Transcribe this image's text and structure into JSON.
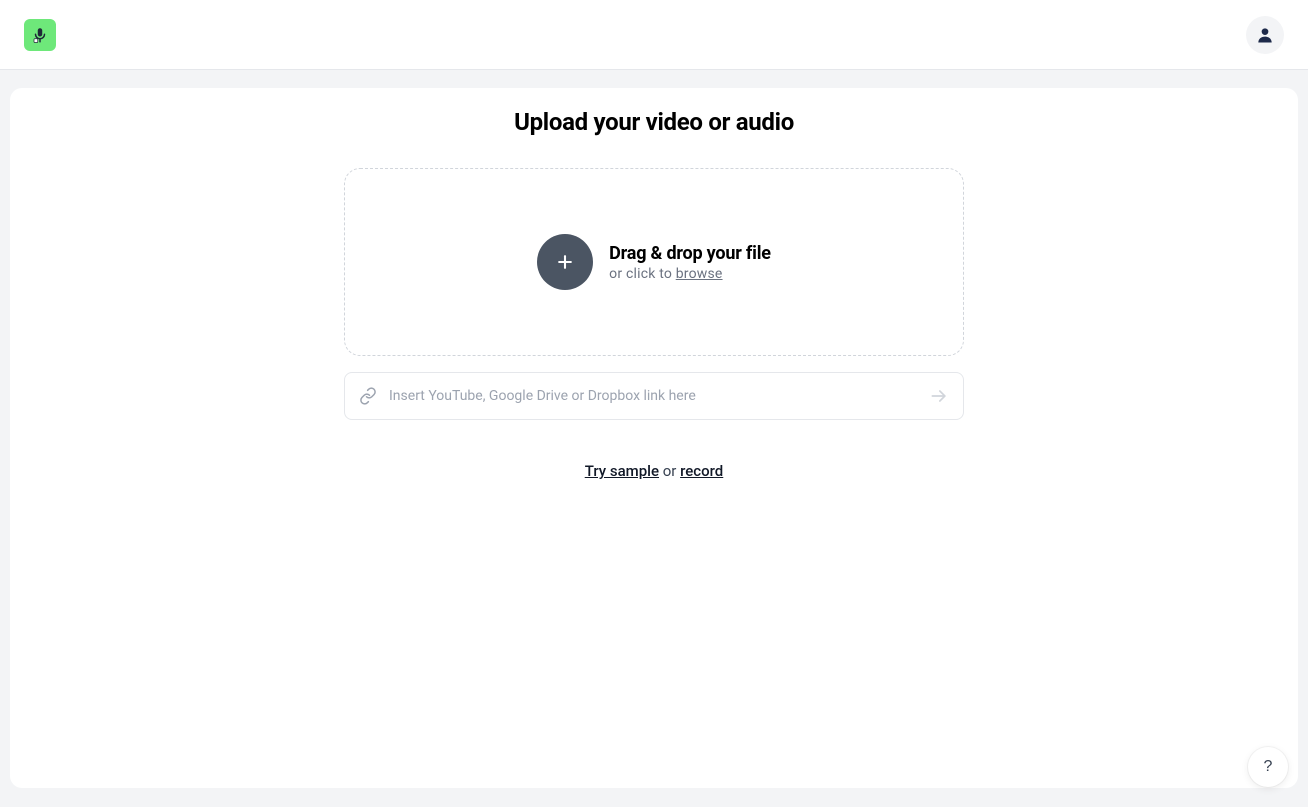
{
  "header": {
    "logo_name": "app-logo",
    "avatar_name": "user-avatar"
  },
  "main": {
    "title": "Upload your video or audio",
    "dropzone": {
      "heading": "Drag & drop your file",
      "subtext_prefix": "or click to ",
      "browse_label": "browse"
    },
    "link_input": {
      "placeholder": "Insert YouTube, Google Drive or Dropbox link here",
      "value": ""
    },
    "helper": {
      "try_sample_label": "Try sample",
      "or_label": " or ",
      "record_label": "record"
    }
  },
  "help_button": {
    "label": "?"
  }
}
